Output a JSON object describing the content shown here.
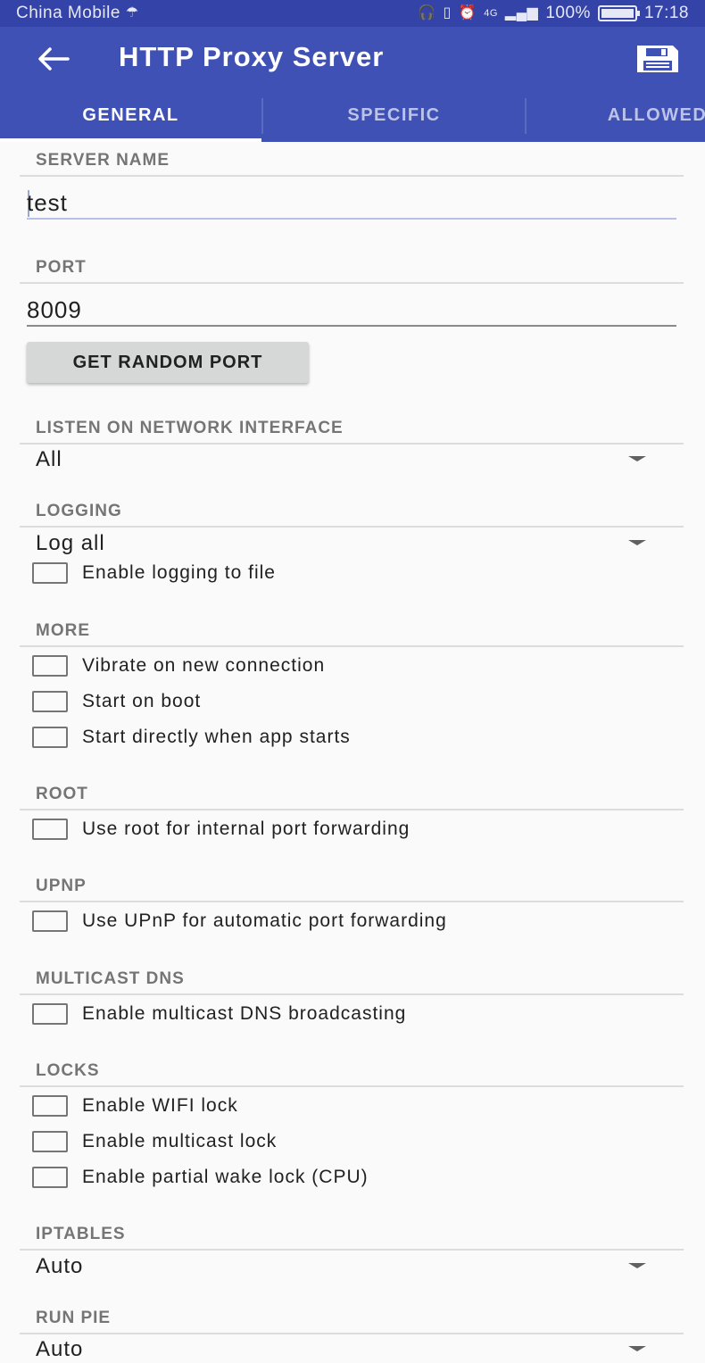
{
  "status_bar": {
    "carrier": "China Mobile",
    "network": "4G",
    "battery": "100%",
    "time": "17:18"
  },
  "toolbar": {
    "title": "HTTP Proxy Server",
    "back_icon": "arrow-back-icon",
    "save_icon": "save-icon"
  },
  "tabs": [
    {
      "label": "GENERAL",
      "active": true
    },
    {
      "label": "SPECIFIC",
      "active": false
    },
    {
      "label": "ALLOWED",
      "active": false
    }
  ],
  "server_name": {
    "header": "SERVER NAME",
    "value": "test"
  },
  "port": {
    "header": "PORT",
    "value": "8009",
    "random_button": "GET RANDOM PORT"
  },
  "listen": {
    "header": "LISTEN ON NETWORK INTERFACE",
    "selected": "All"
  },
  "logging": {
    "header": "LOGGING",
    "selected": "Log all",
    "file_checkbox": {
      "label": "Enable logging to file",
      "checked": false
    }
  },
  "more": {
    "header": "MORE",
    "options": [
      {
        "label": "Vibrate on new connection",
        "checked": false
      },
      {
        "label": "Start on boot",
        "checked": false
      },
      {
        "label": "Start directly when app starts",
        "checked": false
      }
    ]
  },
  "root": {
    "header": "ROOT",
    "options": [
      {
        "label": "Use root for internal port forwarding",
        "checked": false
      }
    ]
  },
  "upnp": {
    "header": "UPNP",
    "options": [
      {
        "label": "Use UPnP for automatic port forwarding",
        "checked": false
      }
    ]
  },
  "multicast_dns": {
    "header": "MULTICAST DNS",
    "options": [
      {
        "label": "Enable multicast DNS broadcasting",
        "checked": false
      }
    ]
  },
  "locks": {
    "header": "LOCKS",
    "options": [
      {
        "label": "Enable WIFI lock",
        "checked": false
      },
      {
        "label": "Enable multicast lock",
        "checked": false
      },
      {
        "label": "Enable partial wake lock (CPU)",
        "checked": false
      }
    ]
  },
  "iptables": {
    "header": "IPTABLES",
    "selected": "Auto"
  },
  "run_pie": {
    "header": "RUN PIE",
    "selected": "Auto"
  },
  "colors": {
    "primary": "#3f51b5",
    "status_bar": "#3443a8",
    "background": "#fafafa",
    "section_header": "#757575"
  }
}
